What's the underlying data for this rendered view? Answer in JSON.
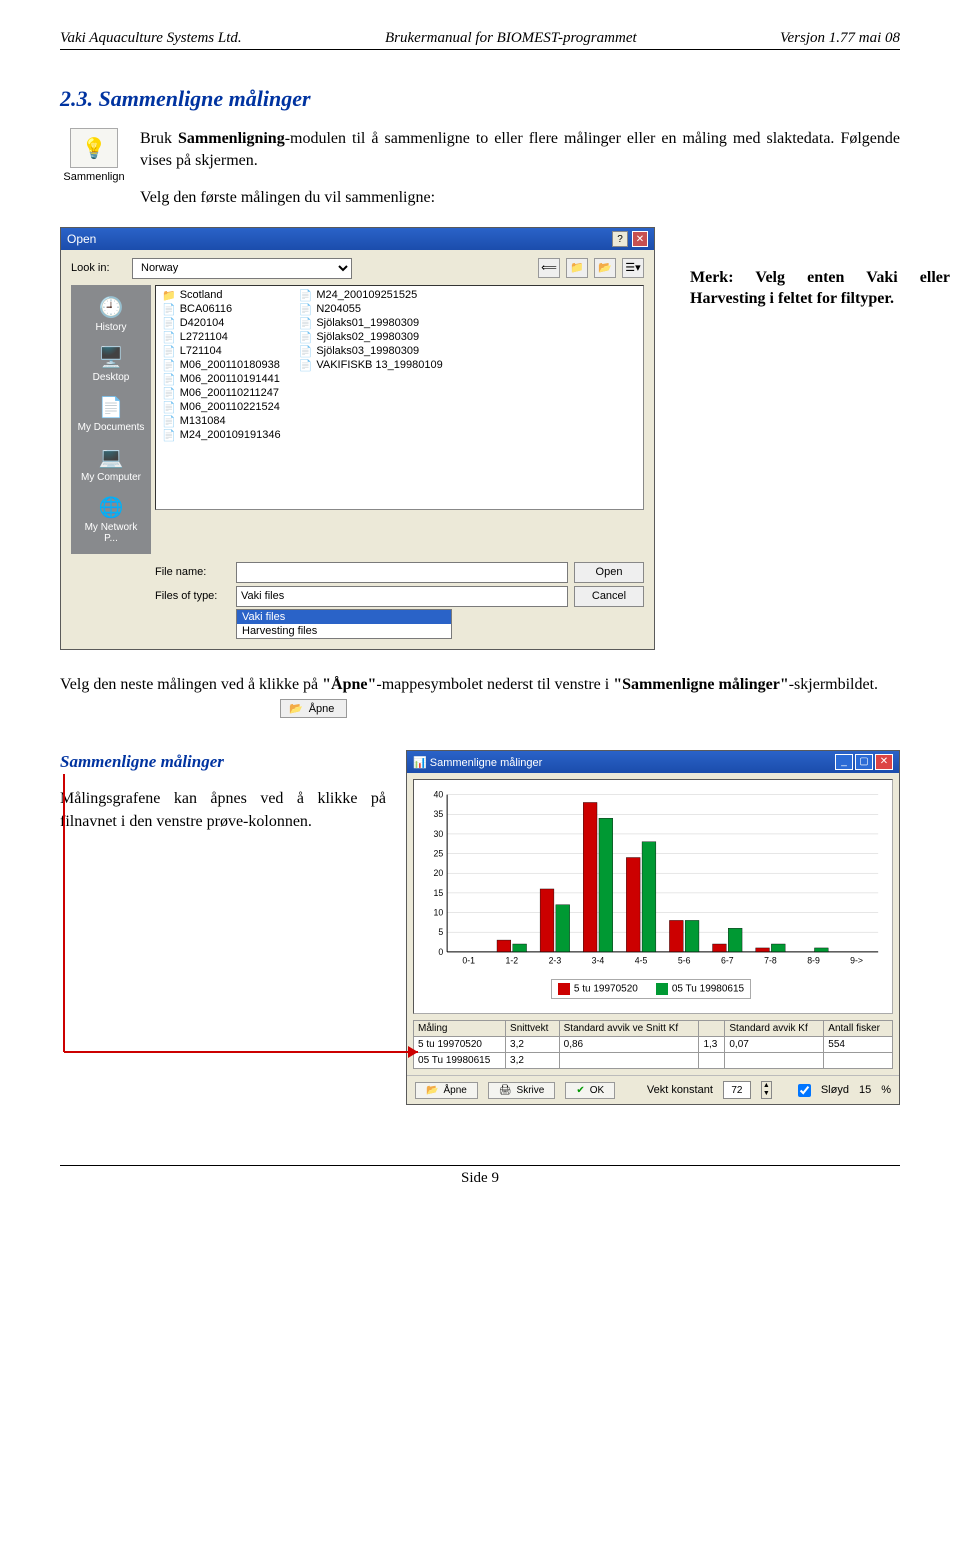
{
  "header": {
    "left": "Vaki Aquaculture Systems Ltd.",
    "center": "Brukermanual for BIOMEST-programmet",
    "right": "Versjon 1.77  mai 08"
  },
  "section": {
    "number_title": "2.3. Sammenligne målinger",
    "module_label": "Sammenlign",
    "intro_p1_prefix": "Bruk ",
    "intro_p1_bold": "Sammenligning",
    "intro_p1_suffix": "-modulen til å sammenligne to eller flere målinger eller en måling med slaktedata. Følgende vises på skjermen.",
    "intro_p2": "Velg den første målingen du vil sammenligne:"
  },
  "open_dialog": {
    "title": "Open",
    "look_in_label": "Look in:",
    "look_in_value": "Norway",
    "places": [
      {
        "icon": "🕘",
        "label": "History"
      },
      {
        "icon": "🖥️",
        "label": "Desktop"
      },
      {
        "icon": "📄",
        "label": "My Documents"
      },
      {
        "icon": "💻",
        "label": "My Computer"
      },
      {
        "icon": "🌐",
        "label": "My Network P..."
      }
    ],
    "files_col1": [
      {
        "icon": "📁",
        "name": "Scotland"
      },
      {
        "icon": "📄",
        "name": "BCA06116"
      },
      {
        "icon": "📄",
        "name": "D420104"
      },
      {
        "icon": "📄",
        "name": "L2721104"
      },
      {
        "icon": "📄",
        "name": "L721104"
      },
      {
        "icon": "📄",
        "name": "M06_200110180938"
      },
      {
        "icon": "📄",
        "name": "M06_200110191441"
      },
      {
        "icon": "📄",
        "name": "M06_200110211247"
      },
      {
        "icon": "📄",
        "name": "M06_200110221524"
      },
      {
        "icon": "📄",
        "name": "M131084"
      },
      {
        "icon": "📄",
        "name": "M24_200109191346"
      }
    ],
    "files_col2": [
      {
        "icon": "📄",
        "name": "M24_200109251525"
      },
      {
        "icon": "📄",
        "name": "N204055"
      },
      {
        "icon": "📄",
        "name": "Sjölaks01_19980309"
      },
      {
        "icon": "📄",
        "name": "Sjölaks02_19980309"
      },
      {
        "icon": "📄",
        "name": "Sjölaks03_19980309"
      },
      {
        "icon": "📄",
        "name": "VAKIFISKB 13_19980109"
      }
    ],
    "file_name_label": "File name:",
    "file_name_value": "",
    "files_of_type_label": "Files of type:",
    "files_of_type_value": "Vaki files",
    "ft_options": [
      "Vaki files",
      "Harvesting files"
    ],
    "open_btn": "Open",
    "cancel_btn": "Cancel"
  },
  "side_note": "Merk: Velg enten Vaki eller Harvesting i feltet for filtyper.",
  "after_paragraph_pre": "Velg den neste målingen ved å klikke på ",
  "after_paragraph_q1": "\"Åpne\"",
  "after_paragraph_mid": "-mappesymbolet nederst til venstre i ",
  "after_paragraph_q2": "\"Sammenligne målinger\"",
  "after_paragraph_post": "-skjermbildet.",
  "apne_label": "Åpne",
  "sammenligne_block": {
    "heading": "Sammenligne målinger",
    "text": "Målingsgrafene kan åpnes ved å klikke på filnavnet i den venstre prøve-kolonnen."
  },
  "sam_window": {
    "title": "Sammenligne målinger",
    "legend": [
      {
        "color": "#cc0000",
        "label": "5 tu 19970520"
      },
      {
        "color": "#009933",
        "label": "05 Tu 19980615"
      }
    ],
    "table": {
      "headers": [
        "Måling",
        "Snittvekt",
        "Standard avvik ve Snitt Kf",
        "",
        "Standard avvik Kf",
        "Antall fisker"
      ],
      "rows": [
        [
          "5 tu 19970520",
          "3,2",
          "0,86",
          "1,3",
          "0,07",
          "554"
        ],
        [
          "05 Tu 19980615",
          "3,2",
          "",
          "",
          "",
          ""
        ]
      ]
    },
    "toolbar": {
      "apne": "Åpne",
      "skrive": "Skrive",
      "ok": "OK",
      "vekt_label": "Vekt konstant",
      "vekt_value": "72",
      "sloyd_label": "Sløyd",
      "sloyd_value": "15",
      "sloyd_unit": "%"
    }
  },
  "chart_data": {
    "type": "bar",
    "categories": [
      "0-1",
      "1-2",
      "2-3",
      "3-4",
      "4-5",
      "5-6",
      "6-7",
      "7-8",
      "8-9",
      "9->"
    ],
    "series": [
      {
        "name": "5 tu 19970520",
        "color": "#cc0000",
        "values": [
          0,
          3,
          16,
          38,
          24,
          8,
          2,
          1,
          0,
          0
        ]
      },
      {
        "name": "05 Tu 19980615",
        "color": "#009933",
        "values": [
          0,
          2,
          12,
          34,
          28,
          8,
          6,
          2,
          1,
          0
        ]
      }
    ],
    "ylim": [
      0,
      40
    ],
    "yticks": [
      0,
      5,
      10,
      15,
      20,
      25,
      30,
      35,
      40
    ],
    "xlabel": "",
    "ylabel": "",
    "title": ""
  },
  "footer_text": "Side 9"
}
